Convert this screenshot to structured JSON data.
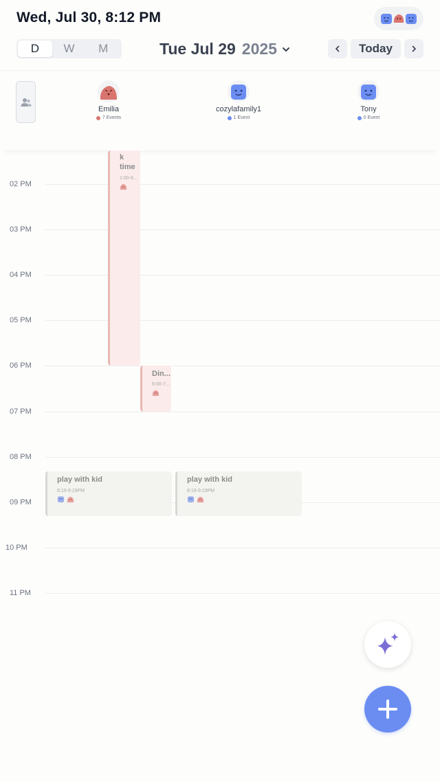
{
  "status": {
    "datetime": "Wed, Jul 30, 8:12 PM"
  },
  "header": {
    "views": [
      {
        "label": "D",
        "active": true
      },
      {
        "label": "W",
        "active": false
      },
      {
        "label": "M",
        "active": false
      }
    ],
    "date": "Tue Jul 29",
    "year": "2025",
    "today_label": "Today",
    "icons": {
      "prev": "chevron-left-icon",
      "next": "chevron-right-icon",
      "dropdown": "chevron-down-icon"
    }
  },
  "members": [
    {
      "name": "Emilia",
      "count": "7 Events",
      "color": "#d9746e",
      "avatar": "pink-blob-avatar"
    },
    {
      "name": "cozylafamily1",
      "count": "1 Event",
      "color": "#6b8df2",
      "avatar": "blue-square-avatar"
    },
    {
      "name": "Tony",
      "count": "0 Event",
      "color": "#6b8df2",
      "avatar": "blue-square-avatar"
    }
  ],
  "hours": [
    "02 PM",
    "03 PM",
    "04 PM",
    "05 PM",
    "06 PM",
    "07 PM",
    "08 PM",
    "09 PM",
    "10 PM",
    "11 PM"
  ],
  "events": [
    {
      "title": "k\ntime",
      "title_line1": "k",
      "title_line2": "time",
      "time": "1:00-6...",
      "color": "pink"
    },
    {
      "title": "Din...",
      "time": "6:00-7...",
      "color": "pink"
    },
    {
      "title": "play with kid",
      "time": "8:19-9:19PM",
      "color": "gray"
    },
    {
      "title": "play with kid",
      "time": "8:19-9:19PM",
      "color": "gray"
    }
  ],
  "colors": {
    "accent": "#6b8df2",
    "pink": "#d9746e",
    "sparkle": "#7b6fd6"
  }
}
